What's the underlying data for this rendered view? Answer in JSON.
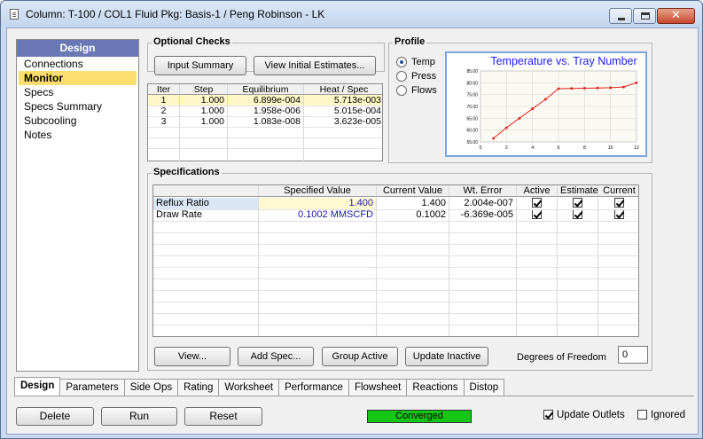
{
  "window": {
    "title": "Column: T-100 / COL1  Fluid Pkg: Basis-1 / Peng Robinson - LK",
    "close_glyph": "✕"
  },
  "nav": {
    "header": "Design",
    "items": [
      {
        "label": "Connections"
      },
      {
        "label": "Monitor",
        "selected": true
      },
      {
        "label": "Specs"
      },
      {
        "label": "Specs Summary"
      },
      {
        "label": "Subcooling"
      },
      {
        "label": "Notes"
      }
    ]
  },
  "optional_checks": {
    "title": "Optional Checks",
    "input_summary_label": "Input Summary",
    "view_initial_label": "View Initial Estimates..."
  },
  "iter_table": {
    "headers": [
      "Iter",
      "Step",
      "Equilibrium",
      "Heat / Spec"
    ],
    "rows": [
      [
        "1",
        "1.000",
        "6.899e-004",
        "5.713e-003"
      ],
      [
        "2",
        "1.000",
        "1.958e-006",
        "5.015e-004"
      ],
      [
        "3",
        "1.000",
        "1.083e-008",
        "3.623e-005"
      ]
    ]
  },
  "profile": {
    "title": "Profile",
    "options": [
      {
        "label": "Temp",
        "selected": true
      },
      {
        "label": "Press",
        "selected": false
      },
      {
        "label": "Flows",
        "selected": false
      }
    ]
  },
  "chart_data": {
    "type": "line",
    "title": "Temperature vs. Tray Number",
    "xlabel": "",
    "ylabel": "",
    "x": [
      1,
      2,
      3,
      4,
      5,
      6,
      7,
      8,
      9,
      10,
      11,
      12
    ],
    "series": [
      {
        "values": [
          56.5,
          61.0,
          65.0,
          69.0,
          73.0,
          77.5,
          77.6,
          77.7,
          77.8,
          77.9,
          78.2,
          80.0
        ]
      }
    ],
    "xlim": [
      0,
      12
    ],
    "ylim": [
      55,
      85
    ],
    "xticks": [
      "0",
      "2",
      "4",
      "6",
      "8",
      "10",
      "12"
    ],
    "yticks": [
      "55.00",
      "60.00",
      "65.00",
      "70.00",
      "75.00",
      "80.00",
      "85.00"
    ],
    "grid": true,
    "line_color": "#e02020",
    "title_color": "#1a1aff"
  },
  "specifications": {
    "title": "Specifications",
    "headers": [
      "",
      "Specified Value",
      "Current Value",
      "Wt. Error",
      "Active",
      "Estimate",
      "Current"
    ],
    "rows": [
      {
        "name": "Reflux Ratio",
        "specified": "1.400",
        "current": "1.400",
        "error": "2.004e-007",
        "active": true,
        "estimate": true,
        "current_chk": true
      },
      {
        "name": "Draw Rate",
        "specified": "0.1002 MMSCFD",
        "current": "0.1002",
        "error": "-6.369e-005",
        "active": true,
        "estimate": true,
        "current_chk": true
      }
    ],
    "view_label": "View...",
    "add_spec_label": "Add Spec...",
    "group_active_label": "Group Active",
    "update_inactive_label": "Update Inactive",
    "dof_label": "Degrees of Freedom",
    "dof_value": "0"
  },
  "tabs": [
    "Design",
    "Parameters",
    "Side Ops",
    "Rating",
    "Worksheet",
    "Performance",
    "Flowsheet",
    "Reactions",
    "Distop"
  ],
  "bottom": {
    "delete_label": "Delete",
    "run_label": "Run",
    "reset_label": "Reset",
    "status": "Converged",
    "status_color": "#15c615",
    "update_outlets_label": "Update Outlets",
    "update_outlets_checked": true,
    "ignored_label": "Ignored",
    "ignored_checked": false
  }
}
